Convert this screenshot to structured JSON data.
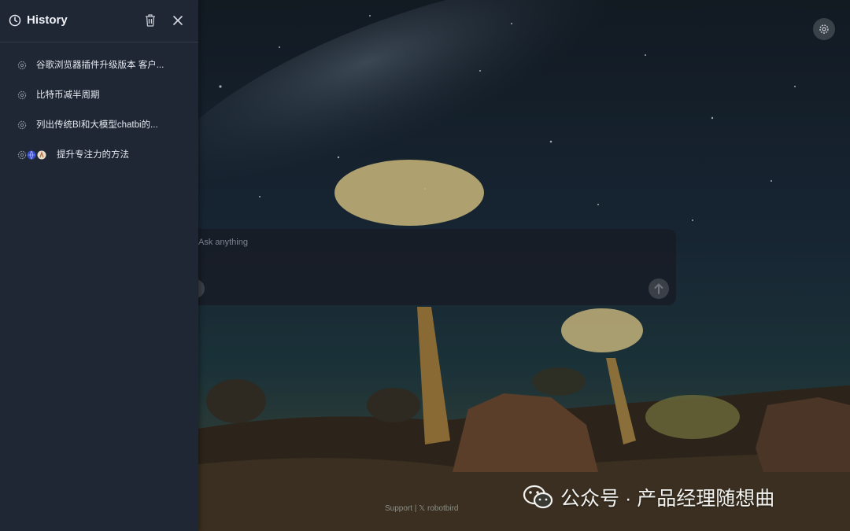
{
  "sidebar": {
    "title": "History",
    "items": [
      {
        "label": "谷歌浏览器插件升级版本 客户...",
        "icons": [
          "openai-icon"
        ]
      },
      {
        "label": "比特币减半周期",
        "icons": [
          "openai-icon"
        ]
      },
      {
        "label": "列出传统BI和大模型chatbi的...",
        "icons": [
          "openai-icon"
        ]
      },
      {
        "label": "提升专注力的方法",
        "icons": [
          "openai-icon",
          "globe-icon",
          "claude-icon"
        ]
      }
    ]
  },
  "ask": {
    "placeholder": "Ask anything",
    "input_value": ""
  },
  "footer": {
    "support": "Support | 𝕏 robotbird"
  },
  "watermark": {
    "text": "公众号 · 产品经理随想曲"
  },
  "colors": {
    "sidebar_bg": "#1f2735",
    "ask_box_bg": "#181c26",
    "text_primary": "#e6e9ef"
  }
}
